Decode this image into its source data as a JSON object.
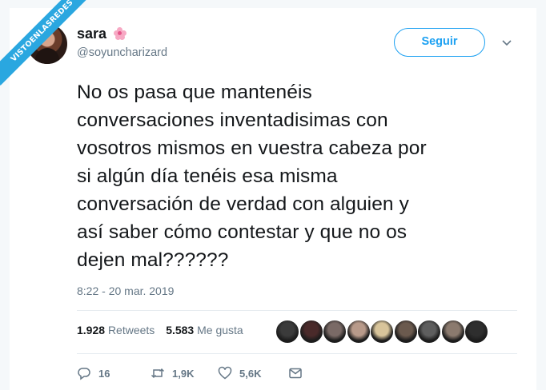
{
  "watermark": {
    "text": "VISTOENLASREDES"
  },
  "user": {
    "display_name": "sara",
    "handle": "@soyuncharizard",
    "name_emoji": "cherry-blossom-icon"
  },
  "follow_button": {
    "label": "Seguir"
  },
  "tweet": {
    "text": "No os pasa que mantenéis\nconversaciones inventadisimas con\nvosotros mismos en vuestra cabeza por\nsi algún día tenéis esa misma\nconversación de verdad con alguien y\nasí saber cómo contestar y que no os\ndejen mal??????",
    "timestamp": "8:22 - 20 mar. 2019"
  },
  "stats": {
    "retweets_count": "1.928",
    "retweets_label": "Retweets",
    "likes_count": "5.583",
    "likes_label": "Me gusta"
  },
  "likers": [
    {
      "color": "#3b3b3b"
    },
    {
      "color": "#4a2a2a"
    },
    {
      "color": "#7a6a66"
    },
    {
      "color": "#b89a8a"
    },
    {
      "color": "#d8c49a"
    },
    {
      "color": "#6b5a4e"
    },
    {
      "color": "#5e5e5e"
    },
    {
      "color": "#8b7a6e"
    },
    {
      "color": "#2e2e2e"
    }
  ],
  "actions": {
    "reply_count": "16",
    "retweet_count": "1,9K",
    "like_count": "5,6K"
  },
  "colors": {
    "accent": "#1da1f2",
    "muted": "#657786",
    "text": "#14171a",
    "ribbon": "#2aa7e0"
  }
}
